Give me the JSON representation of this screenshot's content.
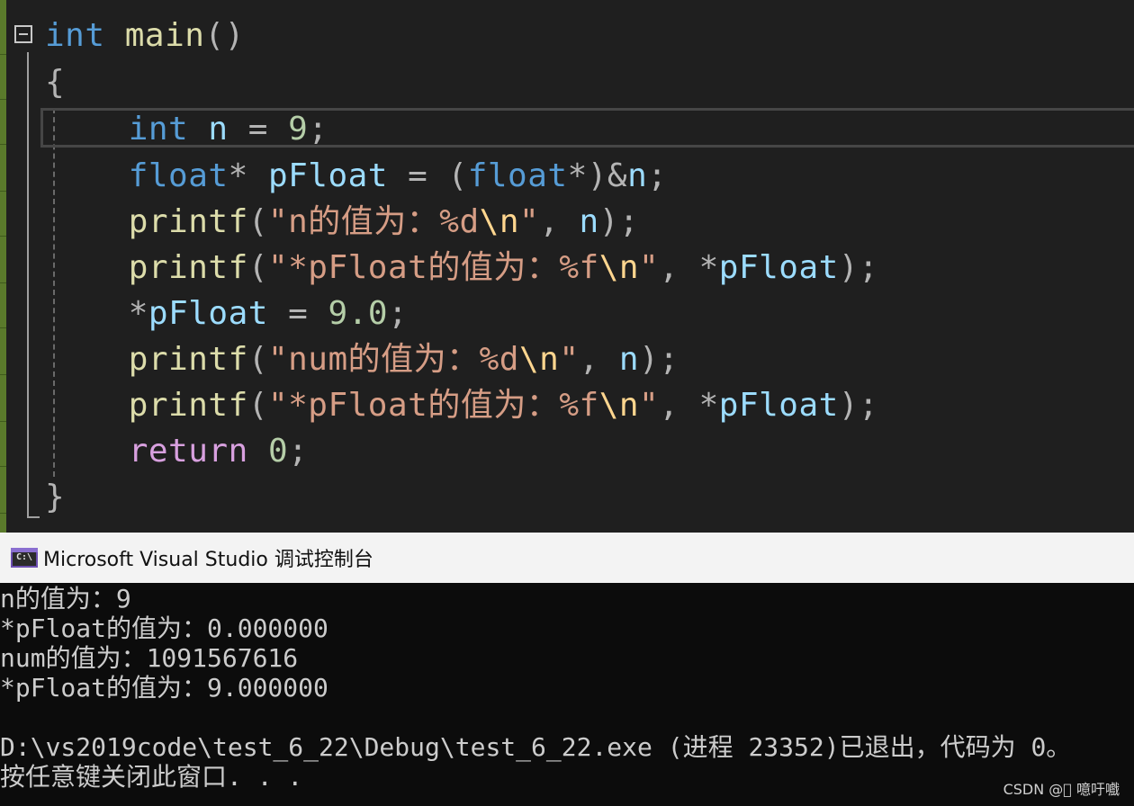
{
  "editor": {
    "lines": [
      {
        "tokens": [
          {
            "t": "int",
            "c": "kw"
          },
          {
            "t": " "
          },
          {
            "t": "main",
            "c": "fn"
          },
          {
            "t": "()",
            "c": "pun"
          }
        ]
      },
      {
        "tokens": [
          {
            "t": "{",
            "c": "pun"
          }
        ]
      },
      {
        "tokens": [
          {
            "t": "    "
          },
          {
            "t": "int",
            "c": "kw"
          },
          {
            "t": " "
          },
          {
            "t": "n",
            "c": "var"
          },
          {
            "t": " = ",
            "c": "pun"
          },
          {
            "t": "9",
            "c": "num"
          },
          {
            "t": ";",
            "c": "pun"
          }
        ]
      },
      {
        "tokens": [
          {
            "t": "    "
          },
          {
            "t": "float",
            "c": "kw"
          },
          {
            "t": "* ",
            "c": "pun"
          },
          {
            "t": "pFloat",
            "c": "var"
          },
          {
            "t": " = (",
            "c": "pun"
          },
          {
            "t": "float",
            "c": "kw"
          },
          {
            "t": "*)&",
            "c": "pun"
          },
          {
            "t": "n",
            "c": "var"
          },
          {
            "t": ";",
            "c": "pun"
          }
        ]
      },
      {
        "tokens": [
          {
            "t": "    "
          },
          {
            "t": "printf",
            "c": "fn"
          },
          {
            "t": "(",
            "c": "pun"
          },
          {
            "t": "\"n的值为：%d",
            "c": "str"
          },
          {
            "t": "\\n",
            "c": "esc"
          },
          {
            "t": "\"",
            "c": "str"
          },
          {
            "t": ", ",
            "c": "pun"
          },
          {
            "t": "n",
            "c": "var"
          },
          {
            "t": ");",
            "c": "pun"
          }
        ]
      },
      {
        "tokens": [
          {
            "t": "    "
          },
          {
            "t": "printf",
            "c": "fn"
          },
          {
            "t": "(",
            "c": "pun"
          },
          {
            "t": "\"*pFloat的值为：%f",
            "c": "str"
          },
          {
            "t": "\\n",
            "c": "esc"
          },
          {
            "t": "\"",
            "c": "str"
          },
          {
            "t": ", *",
            "c": "pun"
          },
          {
            "t": "pFloat",
            "c": "var"
          },
          {
            "t": ");",
            "c": "pun"
          }
        ]
      },
      {
        "tokens": [
          {
            "t": "    "
          },
          {
            "t": "*",
            "c": "pun"
          },
          {
            "t": "pFloat",
            "c": "var"
          },
          {
            "t": " = ",
            "c": "pun"
          },
          {
            "t": "9.0",
            "c": "num"
          },
          {
            "t": ";",
            "c": "pun"
          }
        ]
      },
      {
        "tokens": [
          {
            "t": "    "
          },
          {
            "t": "printf",
            "c": "fn"
          },
          {
            "t": "(",
            "c": "pun"
          },
          {
            "t": "\"num的值为：%d",
            "c": "str"
          },
          {
            "t": "\\n",
            "c": "esc"
          },
          {
            "t": "\"",
            "c": "str"
          },
          {
            "t": ", ",
            "c": "pun"
          },
          {
            "t": "n",
            "c": "var"
          },
          {
            "t": ");",
            "c": "pun"
          }
        ]
      },
      {
        "tokens": [
          {
            "t": "    "
          },
          {
            "t": "printf",
            "c": "fn"
          },
          {
            "t": "(",
            "c": "pun"
          },
          {
            "t": "\"*pFloat的值为：%f",
            "c": "str"
          },
          {
            "t": "\\n",
            "c": "esc"
          },
          {
            "t": "\"",
            "c": "str"
          },
          {
            "t": ", *",
            "c": "pun"
          },
          {
            "t": "pFloat",
            "c": "var"
          },
          {
            "t": ");",
            "c": "pun"
          }
        ]
      },
      {
        "tokens": [
          {
            "t": "    "
          },
          {
            "t": "return",
            "c": "ctl"
          },
          {
            "t": " "
          },
          {
            "t": "0",
            "c": "num"
          },
          {
            "t": ";",
            "c": "pun"
          }
        ]
      },
      {
        "tokens": [
          {
            "t": "}",
            "c": "pun"
          }
        ]
      }
    ]
  },
  "console": {
    "icon": "console-window-icon",
    "title": "Microsoft Visual Studio 调试控制台",
    "lines": [
      "n的值为：9",
      "*pFloat的值为：0.000000",
      "num的值为：1091567616",
      "*pFloat的值为：9.000000",
      "",
      "D:\\vs2019code\\test_6_22\\Debug\\test_6_22.exe (进程 23352)已退出，代码为 0。",
      "按任意键关闭此窗口. . ."
    ]
  },
  "watermark": "CSDN @\u0000 噫吁嚱",
  "colors": {
    "keyword": "#569cd6",
    "function": "#dcdcaa",
    "variable": "#9cdcfe",
    "number": "#b5cea8",
    "string": "#d69d85",
    "escape": "#ffd68f",
    "control": "#d8a0df",
    "editor_bg": "#1f1f1f",
    "console_bg": "#0c0c0c"
  }
}
